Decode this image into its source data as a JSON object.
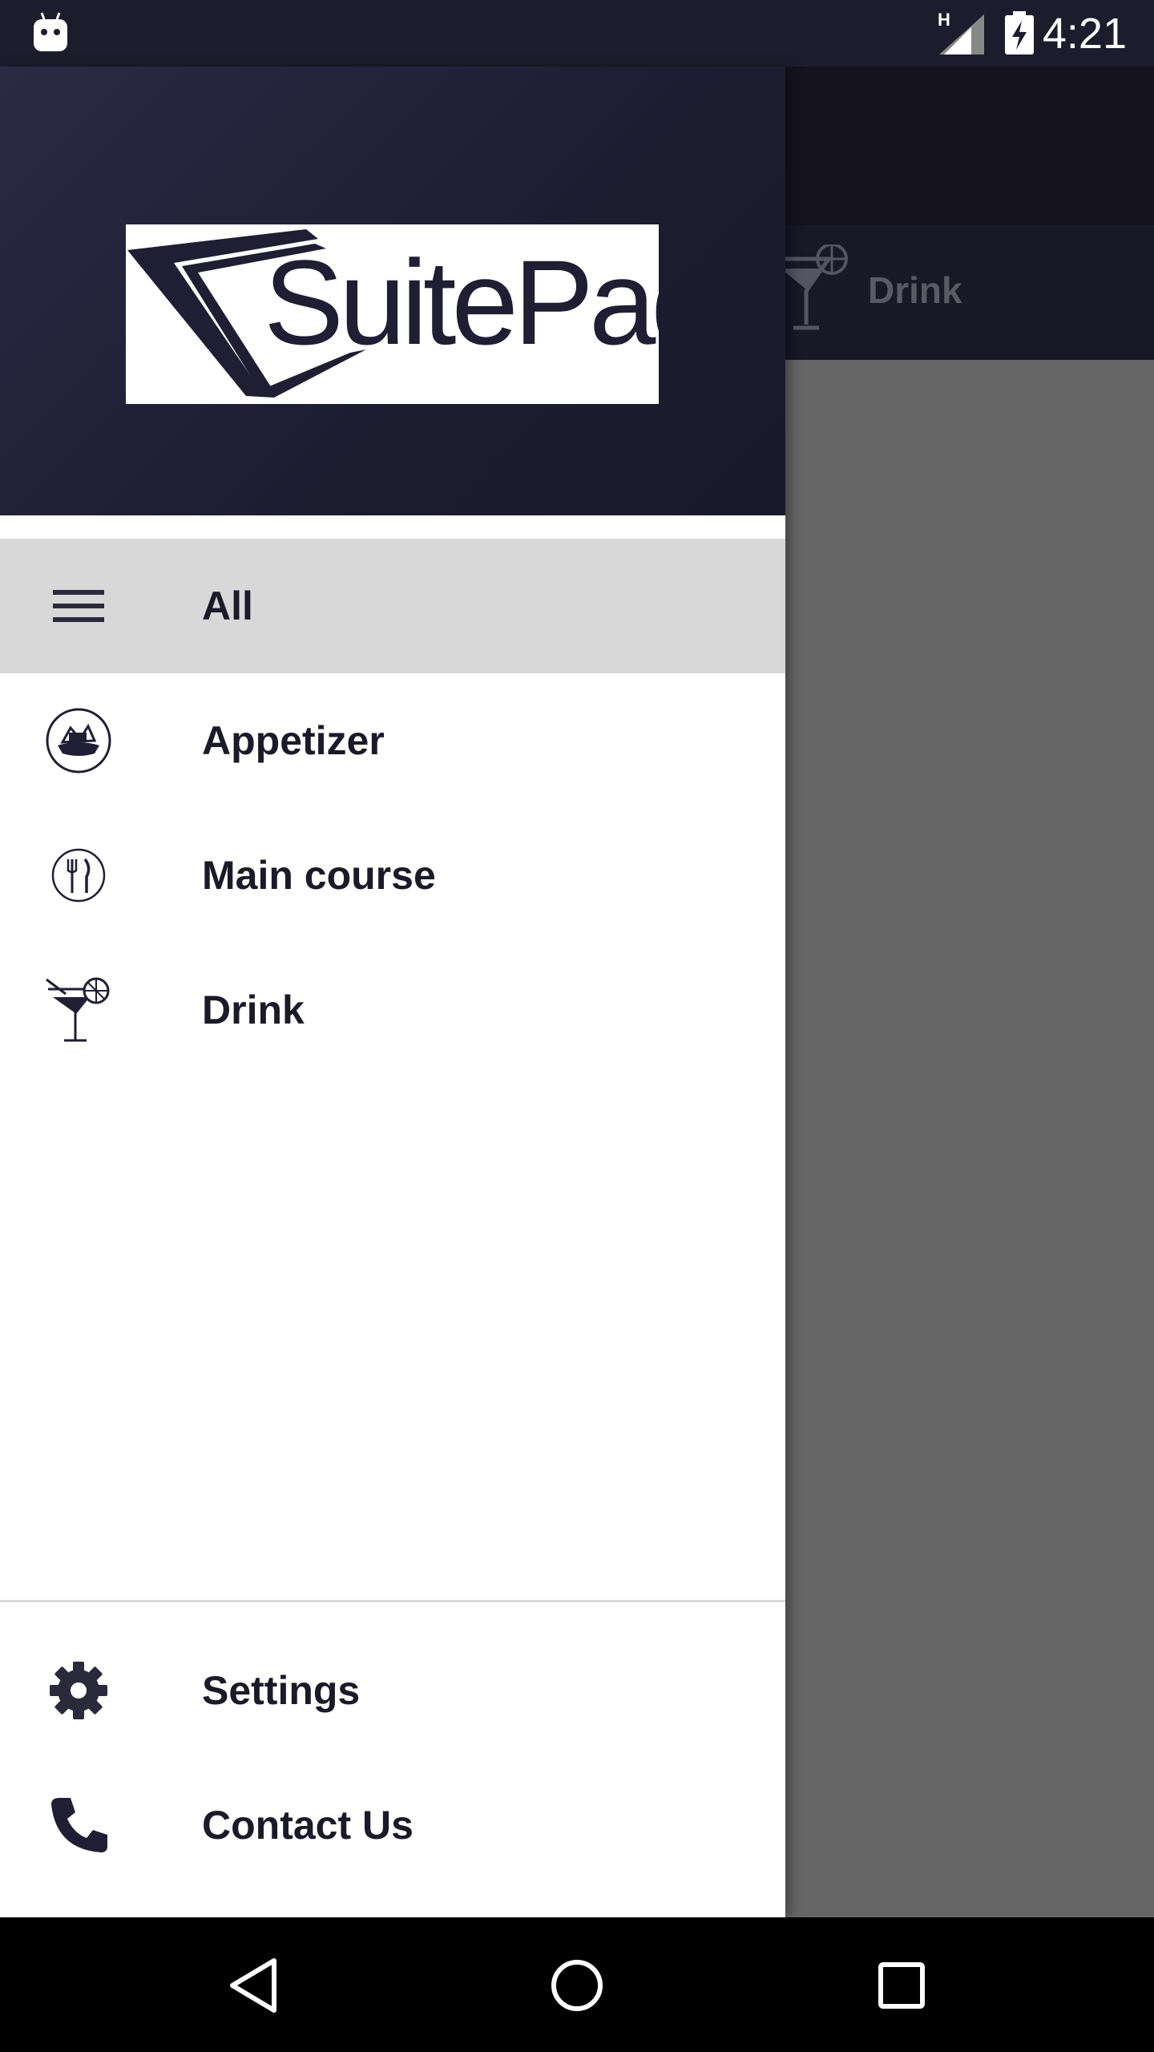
{
  "status_bar": {
    "network_type": "H",
    "time": "4:21"
  },
  "background_app": {
    "tab_label": "Drink",
    "tab_icon": "cocktail-icon"
  },
  "drawer": {
    "logo_text": "SuitePad",
    "menu_items": [
      {
        "label": "All",
        "icon": "menu-icon",
        "selected": true
      },
      {
        "label": "Appetizer",
        "icon": "appetizer-icon",
        "selected": false
      },
      {
        "label": "Main course",
        "icon": "cutlery-icon",
        "selected": false
      },
      {
        "label": "Drink",
        "icon": "cocktail-icon",
        "selected": false
      }
    ],
    "footer_items": [
      {
        "label": "Settings",
        "icon": "gear-icon"
      },
      {
        "label": "Contact Us",
        "icon": "phone-icon"
      }
    ]
  },
  "colors": {
    "header_dark": "#1d1c2f",
    "selected_row": "#d8d8d8",
    "text_dark": "#1b1a28",
    "scrim": "#666666"
  },
  "nav_bar": {
    "back": "back-triangle-icon",
    "home": "home-circle-icon",
    "recents": "recents-square-icon"
  }
}
